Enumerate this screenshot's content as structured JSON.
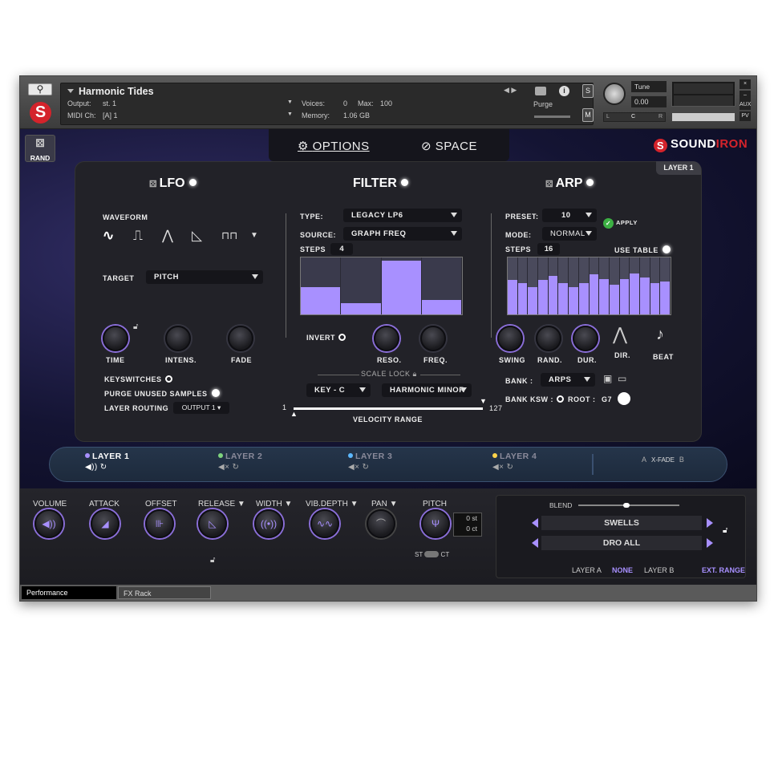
{
  "header": {
    "instrument_name": "Harmonic Tides",
    "output_label": "Output:",
    "output_value": "st. 1",
    "voices_label": "Voices:",
    "voices_value": "0",
    "max_label": "Max:",
    "max_value": "100",
    "midi_label": "MIDI Ch:",
    "midi_value": "[A]  1",
    "memory_label": "Memory:",
    "memory_value": "1.06 GB",
    "purge_label": "Purge",
    "solo_label": "S",
    "mute_label": "M",
    "tune_label": "Tune",
    "tune_value": "0.00",
    "pan_l": "L",
    "pan_c": "C",
    "pan_r": "R",
    "aux_label": "AUX",
    "pv_label": "PV",
    "close_label": "×",
    "min_label": "–"
  },
  "nav": {
    "rand_label": "RAND",
    "tab_options": "OPTIONS",
    "tab_space": "SPACE",
    "brand_a": "SOUND",
    "brand_b": "IRON",
    "brand_logo": "S"
  },
  "panel": {
    "layer_badge": "LAYER 1",
    "lfo": {
      "title": "LFO",
      "waveform_label": "WAVEFORM",
      "target_label": "TARGET",
      "target_value": "PITCH",
      "time_label": "TIME",
      "intens_label": "INTENS.",
      "fade_label": "FADE",
      "keyswitches_label": "KEYSWITCHES",
      "purge_label": "PURGE UNUSED SAMPLES",
      "routing_label": "LAYER ROUTING",
      "routing_value": "OUTPUT 1 ▾"
    },
    "filter": {
      "title": "FILTER",
      "type_label": "TYPE:",
      "type_value": "LEGACY LP6",
      "source_label": "SOURCE:",
      "source_value": "GRAPH FREQ",
      "steps_label": "STEPS",
      "steps_value": "4",
      "steps_levels": [
        0.48,
        0.2,
        0.95,
        0.25
      ],
      "invert_label": "INVERT",
      "reso_label": "RESO.",
      "freq_label": "FREQ.",
      "scale_lock_label": "SCALE LOCK",
      "key_value": "KEY - C",
      "scale_value": "HARMONIC MINOR",
      "vel_min": "1",
      "vel_max": "127",
      "vel_label": "VELOCITY RANGE"
    },
    "arp": {
      "title": "ARP",
      "preset_label": "PRESET:",
      "preset_value": "10",
      "apply_label": "APPLY",
      "mode_label": "MODE:",
      "mode_value": "NORMAL",
      "steps_label": "STEPS",
      "steps_value": "16",
      "use_table_label": "USE TABLE",
      "steps_levels": [
        0.6,
        0.55,
        0.48,
        0.6,
        0.68,
        0.55,
        0.48,
        0.55,
        0.7,
        0.62,
        0.52,
        0.62,
        0.72,
        0.65,
        0.55,
        0.58
      ],
      "swing_label": "SWING",
      "rand_label": "RAND.",
      "dur_label": "DUR.",
      "dir_label": "DIR.",
      "beat_label": "BEAT",
      "bank_label": "BANK :",
      "bank_value": "ARPS",
      "bank_ksw_label": "BANK KSW :",
      "root_label": "ROOT :",
      "root_value": "G7"
    }
  },
  "layers": [
    {
      "label": "LAYER 1",
      "color": "#a890ff",
      "text_color": "#ffffff",
      "sub": "◀)) ↻"
    },
    {
      "label": "LAYER 2",
      "color": "#7ed37e",
      "text_color": "#8a8a9a",
      "sub": "◀× ↻"
    },
    {
      "label": "LAYER 3",
      "color": "#5cb8ff",
      "text_color": "#8a8a9a",
      "sub": "◀× ↻"
    },
    {
      "label": "LAYER 4",
      "color": "#ffd34a",
      "text_color": "#8a8a9a",
      "sub": "◀× ↻"
    }
  ],
  "xfade": {
    "a": "A",
    "b": "B",
    "label": "X-FADE"
  },
  "controls": {
    "volume": "VOLUME",
    "attack": "ATTACK",
    "offset": "OFFSET",
    "release": "RELEASE ▼",
    "width": "WIDTH ▼",
    "vib_depth": "VIB.DEPTH ▼",
    "pan": "PAN ▼",
    "pitch": "PITCH",
    "pitch_st": "0 st",
    "pitch_ct": "0 ct",
    "st_label": "ST",
    "ct_label": "CT"
  },
  "blend": {
    "label": "BLEND",
    "field1": "SWELLS",
    "field2": "DRO ALL",
    "layer_a": "LAYER A",
    "none": "NONE",
    "layer_b": "LAYER B",
    "ext_range": "EXT. RANGE"
  },
  "footer": {
    "tab1": "Performance",
    "tab2": "FX Rack"
  },
  "colors": {
    "accent": "#a890ff",
    "brand_red": "#d4232b",
    "apply_green": "#3cb043"
  }
}
